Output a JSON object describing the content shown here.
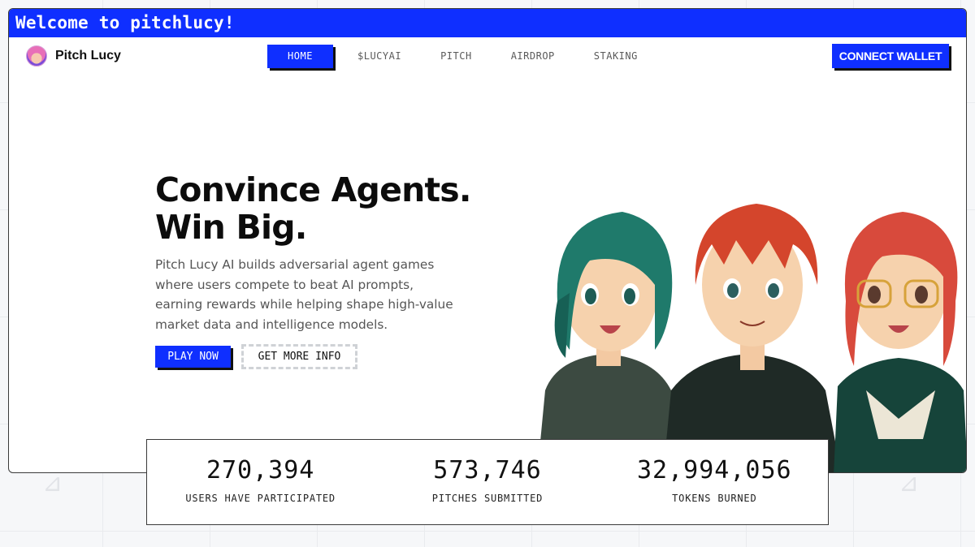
{
  "window": {
    "title": "Welcome to pitchlucy!"
  },
  "nav": {
    "brand": "Pitch Lucy",
    "links": [
      {
        "label": "HOME",
        "active": true
      },
      {
        "label": "$LUCYAI",
        "active": false
      },
      {
        "label": "PITCH",
        "active": false
      },
      {
        "label": "AIRDROP",
        "active": false
      },
      {
        "label": "STAKING",
        "active": false
      }
    ],
    "wallet_button": "CONNECT WALLET"
  },
  "hero": {
    "title_line1": "Convince Agents.",
    "title_line2": "Win Big.",
    "description": "Pitch Lucy AI builds adversarial agent games where users compete to beat AI prompts, earning rewards while helping shape high-value market data and intelligence models.",
    "play_button": "PLAY NOW",
    "info_button": "GET MORE INFO"
  },
  "stats": [
    {
      "value": "270,394",
      "label": "USERS HAVE PARTICIPATED"
    },
    {
      "value": "573,746",
      "label": "PITCHES SUBMITTED"
    },
    {
      "value": "32,994,056",
      "label": "TOKENS BURNED"
    }
  ],
  "colors": {
    "accent": "#0f2fff",
    "text": "#111111",
    "muted": "#555555"
  },
  "icons": {
    "logo": "pitch-lucy-avatar-icon"
  }
}
